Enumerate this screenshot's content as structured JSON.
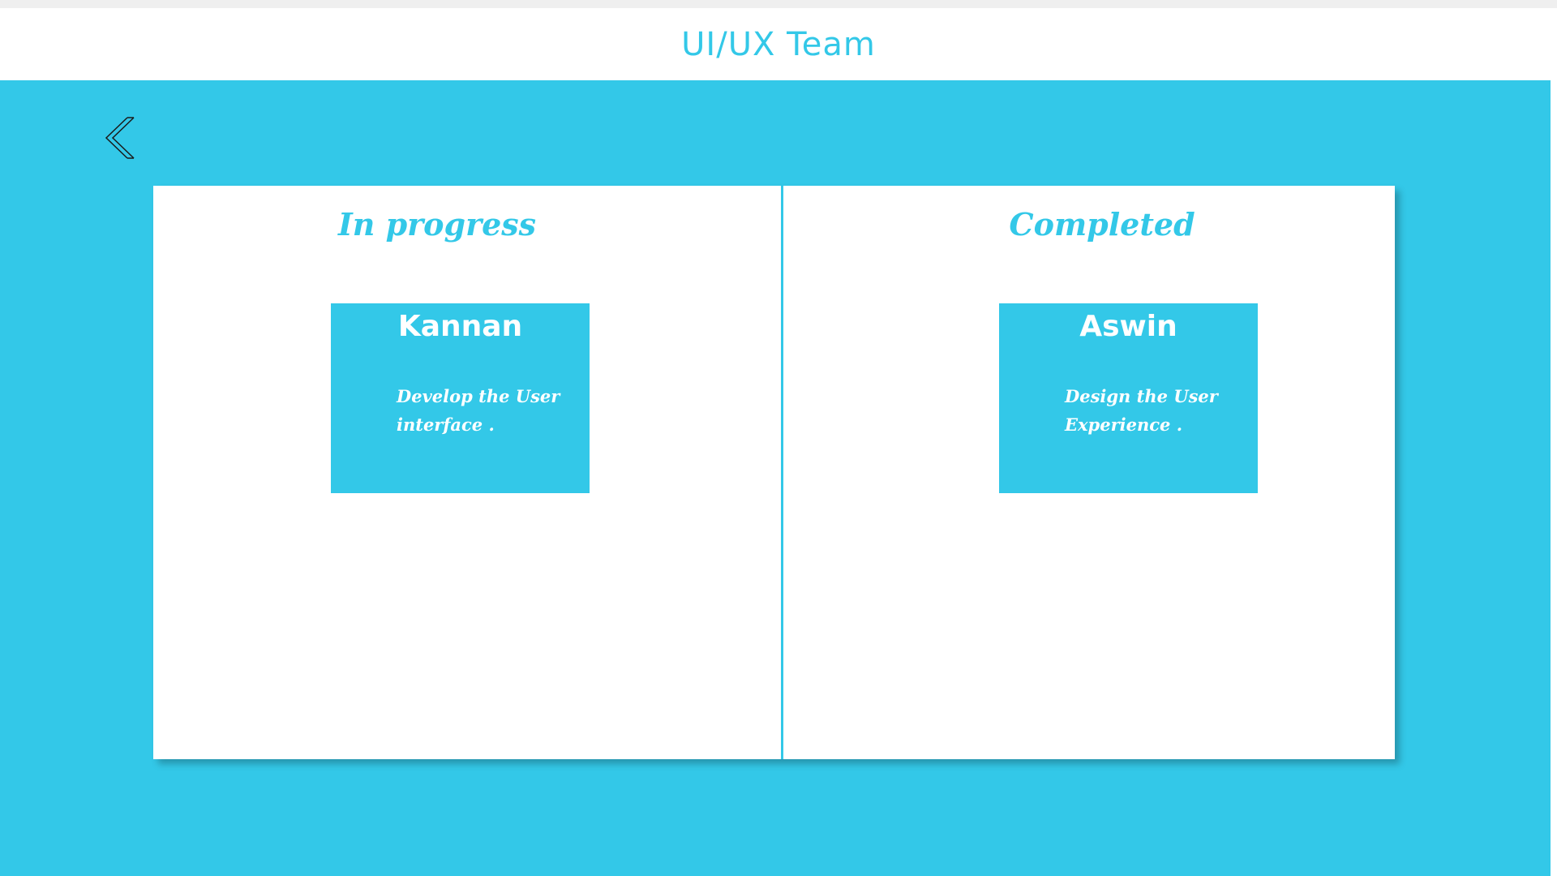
{
  "header": {
    "title": "UI/UX Team"
  },
  "navigation": {
    "back_icon": "chevron-left-icon"
  },
  "board": {
    "columns": [
      {
        "title": "In progress",
        "cards": [
          {
            "name": "Kannan",
            "description": "Develop the User interface ."
          }
        ]
      },
      {
        "title": "Completed",
        "cards": [
          {
            "name": "Aswin",
            "description": "Design the User Experience ."
          }
        ]
      }
    ]
  },
  "colors": {
    "accent": "#33c8e8",
    "background": "#ffffff",
    "card_text": "#ffffff"
  }
}
